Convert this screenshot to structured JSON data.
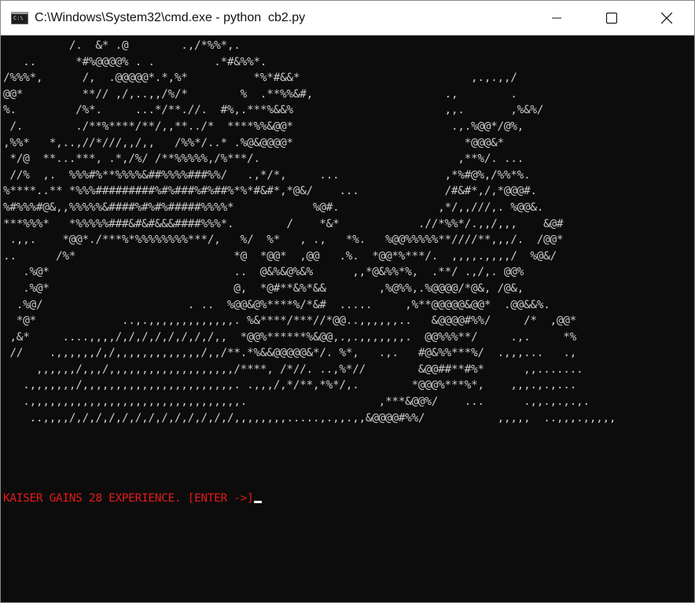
{
  "window": {
    "title": "C:\\Windows\\System32\\cmd.exe - python  cb2.py",
    "icon": "cmd-icon",
    "icon_text": "C:\\"
  },
  "controls": {
    "minimize_icon": "minimize-icon",
    "maximize_icon": "maximize-icon",
    "close_icon": "close-icon"
  },
  "console": {
    "text_color": "#c8c8c8",
    "background": "#0c0c0c",
    "ascii_art": "          /.  &* .@        .,/*%%*,.\n   ..      *#%@@@@% . .         .*#&%%*.\n/%%%*,      /,  .@@@@@*.*,%*          *%*#&&*                          ,.,.,,/\n@@*         **// ,/,..,,/%/*        %  .**%%&#,                    .,        .\n%.         /%*.     ...*/**.//.  #%,.***%&&%                       ,,.       ,%&%/\n /.        ./**%****/**/,,**../*  ****%%&@@*                        .,.%@@*/@%,\n,%%*   *,..,//*///,,/,,   /%%*/..* .%@&@@@@*                          *@@@&*\n */@  **...***, .*,/%/ /**%%%%%,/%***/.                              ,**%/. ...\n //%  ,.  %%%#%**%%%%&##%%%%###%%/   .,*/*,     ...                ,*%#@%,/%%*%.\n%****..** *%%%#########%#%###%#%##%*%*#&#*,*@&/    ...             /#&#*,/,*@@@#.\n%#%%%#@&,,%%%%%&####%#%#%#####%%%%*            %@#.               ,*/,,///,. %@@&.\n***%%%*   *%%%%%###&#&#&&&####%%%*.        /    *&*            .//*%%*/.,,/,,,    &@#\n .,,.    *@@*./***%*%%%%%%%%***/,   %/  %*   , .,   *%.   %@@%%%%%**////**,,,/.  /@@*\n..      /%*                        *@  *@@*  ,@@   .%.  *@@*%***/.  ,,,,.,,,,/  %@&/\n   .%@*                            ..  @&%&@%&%      ,,*@&%%*%,  .**/ .,/,. @@%\n   .%@*                            @,  *@#**&%*&&        ,%@%%,.%@@@@/*@&, /@&,\n  .%@/                      . ..  %@@&@%****%/*&#  .....     ,%**@@@@@&@@*  .@@&&%.\n  *@*             ..,.,,,,,,,,,,,,,. %&****/***//*@@..,,,,,,..   &@@@@#%%/     /*  ,@@*\n ,&*     ....,,,,/,/,/,/,/,/,/,/,,  *@@%******%&@@,.,.,,,,,,,.  @@%%%**/     .,.     *%\n //    .,,,,,,/,/,,,,,,,,,,,,,/,,/**.*%&&@@@@@&*/. %*,   .,.   #@&%%***%/  .,,,...   .,\n     ,,,,,,/,,,/,,,,,,,,,,,,,,,,,,,/****, /*//. ..,%*//        &@@##**#%*      ,,.......\n   .,,,,,,,/,,,,,,,,,,,,,,,,,,,,,,,. .,,,/,*/**,*%*/,.        *@@@%***%*,    ,,,.,.,...\n   .,,,,,,,,,,,,,,,,,,,,,,,,,,,,,,,,.                    ,***&@@%/    ...      .,,.,.,.,.\n    ..,,,,/,/,/,/,/,/,/,/,/,/,/,/,/,,,,,,,,.....,.,,.,,&@@@@#%%/           ,,,,,  ..,,,.,,,,,"
  },
  "prompt": {
    "text": "KAISER GAINS 28 EXPERIENCE. [ENTER ->]",
    "color": "#e41a1a"
  }
}
